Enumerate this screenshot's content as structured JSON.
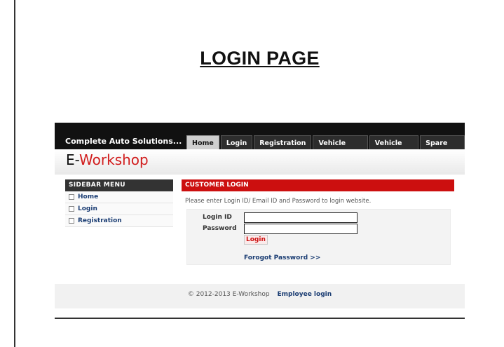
{
  "document": {
    "title": "LOGIN PAGE"
  },
  "site": {
    "tagline": "Complete Auto Solutions...",
    "logo": {
      "prefix": "E-",
      "name": "Workshop"
    },
    "nav": [
      "Home",
      "Login",
      "Registration",
      "Vehicle Service",
      "Vehicle Store",
      "Spare Parts"
    ],
    "active_nav": "Home"
  },
  "sidebar": {
    "heading": "SIDEBAR MENU",
    "items": [
      "Home",
      "Login",
      "Registration"
    ]
  },
  "login": {
    "heading": "CUSTOMER LOGIN",
    "instructions": "Please enter Login ID/ Email ID and Password to login website.",
    "login_id_label": "Login ID",
    "password_label": "Password",
    "login_id_value": "",
    "password_value": "",
    "button": "Login",
    "forgot": "Forogot Password >>"
  },
  "footer": {
    "copyright": "© 2012-2013 E-Workshop",
    "employee_login": "Employee login"
  },
  "colors": {
    "accent": "#cc0f0f",
    "topbar": "#111111",
    "link": "#1b3d73"
  }
}
